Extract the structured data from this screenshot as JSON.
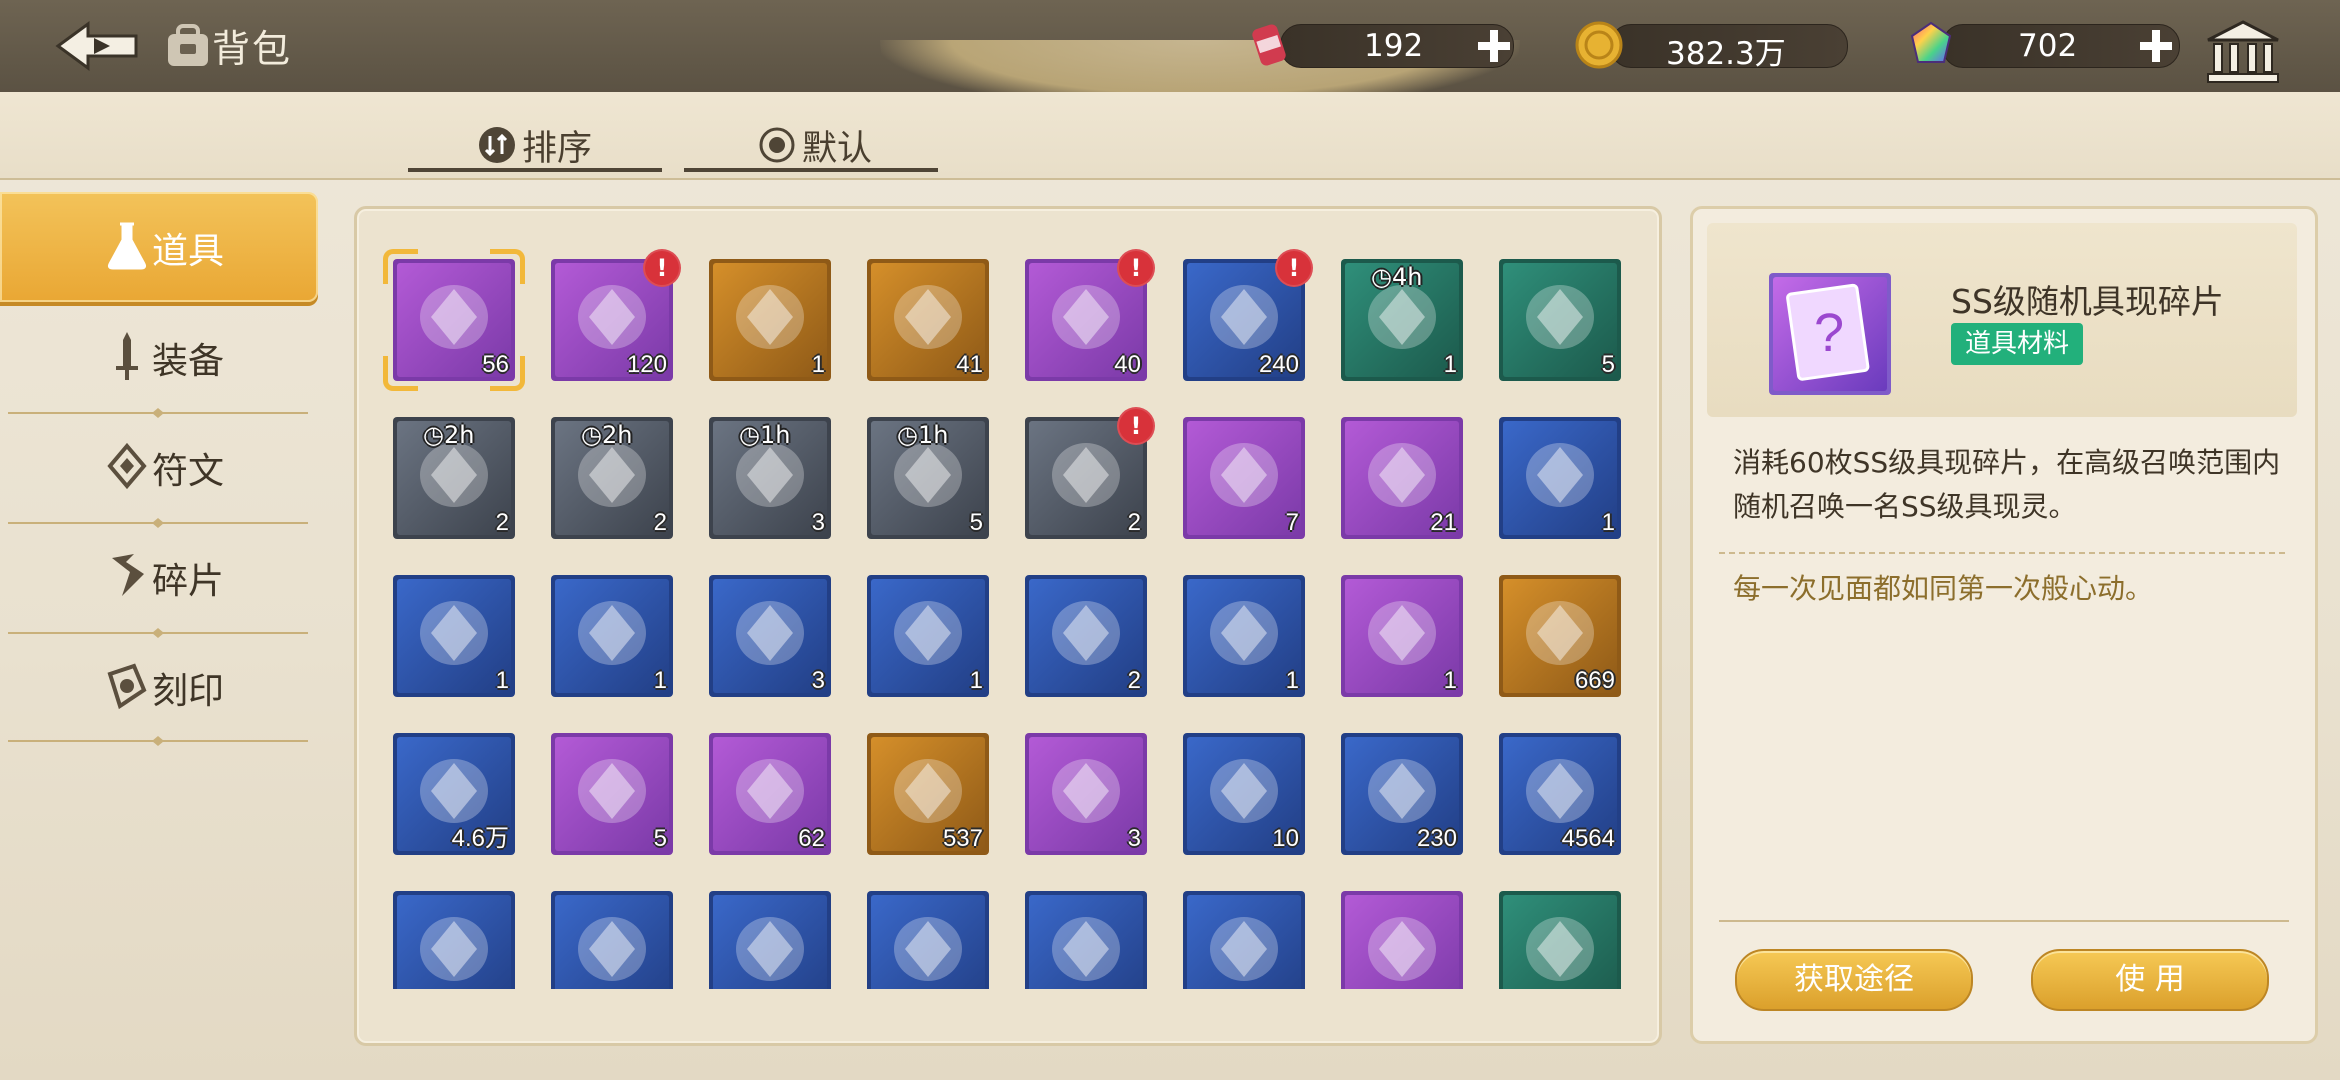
{
  "header": {
    "title": "背包",
    "back_icon": "back-arrow-icon",
    "bag_icon": "backpack-icon"
  },
  "resources": [
    {
      "name": "energy-can",
      "value": "192",
      "icon": "can-icon"
    },
    {
      "name": "gold-coin",
      "value": "382.3万",
      "icon": "coin-icon"
    },
    {
      "name": "rainbow-gem",
      "value": "702",
      "icon": "gem-icon"
    }
  ],
  "sort": {
    "sort_label": "排序",
    "default_label": "默认"
  },
  "nav": {
    "items": [
      {
        "label": "道具",
        "icon": "flask-icon",
        "active": true
      },
      {
        "label": "装备",
        "icon": "sword-icon",
        "active": false
      },
      {
        "label": "符文",
        "icon": "rune-icon",
        "active": false
      },
      {
        "label": "碎片",
        "icon": "shard-icon",
        "active": false
      },
      {
        "label": "刻印",
        "icon": "seal-icon",
        "active": false
      }
    ]
  },
  "grid": {
    "selected_index": 0,
    "items": [
      {
        "quantity": "56",
        "rarity": "purple",
        "icon": "ss-random-shard",
        "alert": false,
        "timer": ""
      },
      {
        "quantity": "120",
        "rarity": "purple",
        "icon": "silhouette-card",
        "alert": true,
        "timer": ""
      },
      {
        "quantity": "1",
        "rarity": "gold",
        "icon": "mystery-crystal",
        "alert": false,
        "timer": ""
      },
      {
        "quantity": "41",
        "rarity": "gold",
        "icon": "mystery-card",
        "alert": false,
        "timer": ""
      },
      {
        "quantity": "40",
        "rarity": "purple",
        "icon": "silhouette-card",
        "alert": true,
        "timer": ""
      },
      {
        "quantity": "240",
        "rarity": "blue",
        "icon": "gift-box",
        "alert": true,
        "timer": ""
      },
      {
        "quantity": "1",
        "rarity": "green",
        "icon": "hourglass-coins",
        "alert": false,
        "timer": "4h"
      },
      {
        "quantity": "5",
        "rarity": "green",
        "icon": "crystal-tiara",
        "alert": false,
        "timer": ""
      },
      {
        "quantity": "2",
        "rarity": "gray",
        "icon": "hourglass-coins",
        "alert": false,
        "timer": "2h"
      },
      {
        "quantity": "2",
        "rarity": "gray",
        "icon": "hourglass-crystals",
        "alert": false,
        "timer": "2h"
      },
      {
        "quantity": "3",
        "rarity": "gray",
        "icon": "hourglass-coins",
        "alert": false,
        "timer": "1h"
      },
      {
        "quantity": "5",
        "rarity": "gray",
        "icon": "hourglass-crystals",
        "alert": false,
        "timer": "1h"
      },
      {
        "quantity": "2",
        "rarity": "gray",
        "icon": "blue-potion",
        "alert": true,
        "timer": ""
      },
      {
        "quantity": "7",
        "rarity": "purple",
        "icon": "flower-bouquet",
        "alert": false,
        "timer": ""
      },
      {
        "quantity": "21",
        "rarity": "purple",
        "icon": "robot-cat",
        "alert": false,
        "timer": ""
      },
      {
        "quantity": "1",
        "rarity": "blue",
        "icon": "green-crystal",
        "alert": false,
        "timer": ""
      },
      {
        "quantity": "1",
        "rarity": "blue",
        "icon": "water-bowl",
        "alert": false,
        "timer": ""
      },
      {
        "quantity": "1",
        "rarity": "blue",
        "icon": "tea-pot",
        "alert": false,
        "timer": ""
      },
      {
        "quantity": "3",
        "rarity": "blue",
        "icon": "pink-perfume",
        "alert": false,
        "timer": ""
      },
      {
        "quantity": "1",
        "rarity": "blue",
        "icon": "open-book",
        "alert": false,
        "timer": ""
      },
      {
        "quantity": "2",
        "rarity": "blue",
        "icon": "milk-carton",
        "alert": false,
        "timer": ""
      },
      {
        "quantity": "1",
        "rarity": "blue",
        "icon": "pink-pillow",
        "alert": false,
        "timer": ""
      },
      {
        "quantity": "1",
        "rarity": "purple",
        "icon": "blue-chip",
        "alert": false,
        "timer": ""
      },
      {
        "quantity": "669",
        "rarity": "gold",
        "icon": "blue-gem",
        "alert": false,
        "timer": ""
      },
      {
        "quantity": "4.6万",
        "rarity": "blue",
        "icon": "white-crystal",
        "alert": false,
        "timer": ""
      },
      {
        "quantity": "5",
        "rarity": "purple",
        "icon": "dagger",
        "alert": false,
        "timer": ""
      },
      {
        "quantity": "62",
        "rarity": "purple",
        "icon": "fashion-tag",
        "alert": false,
        "timer": ""
      },
      {
        "quantity": "537",
        "rarity": "gold",
        "icon": "ticket",
        "alert": false,
        "timer": ""
      },
      {
        "quantity": "3",
        "rarity": "purple",
        "icon": "pliers",
        "alert": false,
        "timer": ""
      },
      {
        "quantity": "10",
        "rarity": "blue",
        "icon": "swirl-orb",
        "alert": false,
        "timer": ""
      },
      {
        "quantity": "230",
        "rarity": "blue",
        "icon": "wrench-coin",
        "alert": false,
        "timer": ""
      },
      {
        "quantity": "4564",
        "rarity": "blue",
        "icon": "robot-cat",
        "alert": false,
        "timer": ""
      },
      {
        "quantity": "",
        "rarity": "blue",
        "icon": "compass-medal",
        "alert": false,
        "timer": ""
      },
      {
        "quantity": "",
        "rarity": "blue",
        "icon": "dynamite",
        "alert": false,
        "timer": ""
      },
      {
        "quantity": "",
        "rarity": "blue",
        "icon": "key",
        "alert": false,
        "timer": ""
      },
      {
        "quantity": "",
        "rarity": "blue",
        "icon": "blue-crystal",
        "alert": false,
        "timer": ""
      },
      {
        "quantity": "",
        "rarity": "blue",
        "icon": "magic-amulet",
        "alert": false,
        "timer": ""
      },
      {
        "quantity": "",
        "rarity": "blue",
        "icon": "silver-coin",
        "alert": false,
        "timer": ""
      },
      {
        "quantity": "",
        "rarity": "purple",
        "icon": "compass-badge",
        "alert": false,
        "timer": ""
      },
      {
        "quantity": "",
        "rarity": "green",
        "icon": "bronze-key",
        "alert": false,
        "timer": ""
      }
    ]
  },
  "detail": {
    "name": "SS级随机具现碎片",
    "tag": "道具材料",
    "description": "消耗60枚SS级具现碎片，在高级召唤范围内随机召唤一名SS级具现灵。",
    "flavor": "每一次见面都如同第一次般心动。",
    "source_button": "获取途径",
    "use_button": "使 用"
  },
  "colors": {
    "accent_gold": "#e9a734",
    "tag_green": "#22b07b",
    "alert_red": "#d8323a",
    "rarity_purple": "#b35ad6",
    "rarity_gold": "#d58f2a",
    "rarity_blue": "#3a68c9",
    "rarity_green": "#2f8f7a",
    "rarity_gray": "#6b7482"
  }
}
